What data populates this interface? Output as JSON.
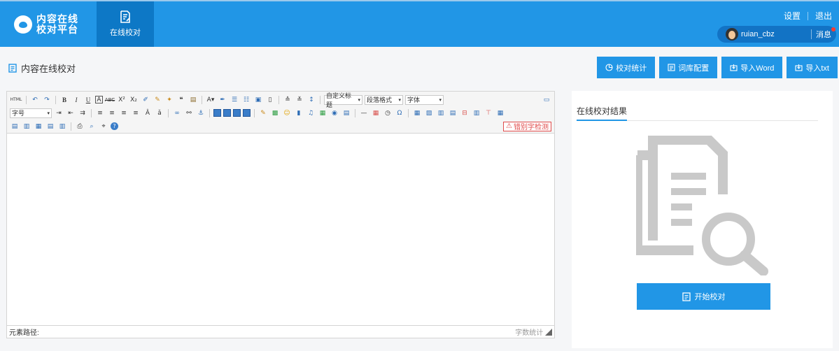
{
  "header": {
    "brand_line1": "内容在线",
    "brand_line2": "校对平台",
    "nav_tab_label": "在线校对",
    "settings_label": "设置",
    "logout_label": "退出",
    "username": "ruian_cbz",
    "message_label": "消息"
  },
  "page": {
    "title": "内容在线校对"
  },
  "actions": {
    "stats_label": "校对统计",
    "dict_label": "词库配置",
    "import_word_label": "导入Word",
    "import_txt_label": "导入txt"
  },
  "editor": {
    "toolbar": {
      "html_label": "HTML",
      "custom_title": "自定义标题",
      "paragraph_format": "段落格式",
      "font_family": "字体",
      "font_size": "字号",
      "typo_check_label": "错别字检测"
    },
    "status_path_label": "元素路径:",
    "word_count_label": "字数统计"
  },
  "result": {
    "tab_label": "在线校对结果",
    "start_button_label": "开始校对"
  },
  "colors": {
    "primary": "#2196e6",
    "nav_active": "#0d78c6",
    "alert": "#e04b4b"
  }
}
